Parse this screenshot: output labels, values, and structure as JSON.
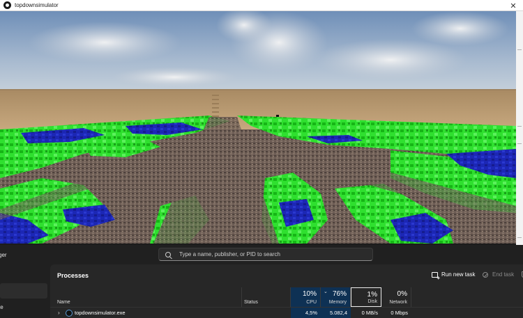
{
  "window": {
    "title": "topdownsimulator",
    "close_glyph": "✕",
    "icon": "app-icon"
  },
  "task_manager": {
    "app_title_fragment": "ger",
    "search": {
      "placeholder": "Type a name, publisher, or PID to search",
      "icon": "search-icon"
    },
    "nav": {
      "fragment_label": "te"
    },
    "page_title": "Processes",
    "toolbar": {
      "run_new_task": "Run new task",
      "end_task": "End task"
    },
    "columns": {
      "name": "Name",
      "status": "Status",
      "cpu": {
        "percent": "10%",
        "label": "CPU"
      },
      "memory": {
        "percent": "76%",
        "label": "Memory"
      },
      "disk": {
        "percent": "1%",
        "label": "Disk"
      },
      "network": {
        "percent": "0%",
        "label": "Network"
      }
    },
    "rows": [
      {
        "name": "topdownsimulator.exe",
        "status": "",
        "cpu": "4,5%",
        "memory": "5.082,4 MB",
        "disk": "0 MB/s",
        "network": "0 Mbps"
      }
    ],
    "colors": {
      "background": "#202020",
      "content": "#272727",
      "highlight": "#0e3154"
    }
  },
  "scene": {
    "sky": "#8fa7c4",
    "wall": "#c0a27a",
    "grass": "#2ee22e",
    "water": "#1f2ab8",
    "path": "#6b5b52"
  }
}
